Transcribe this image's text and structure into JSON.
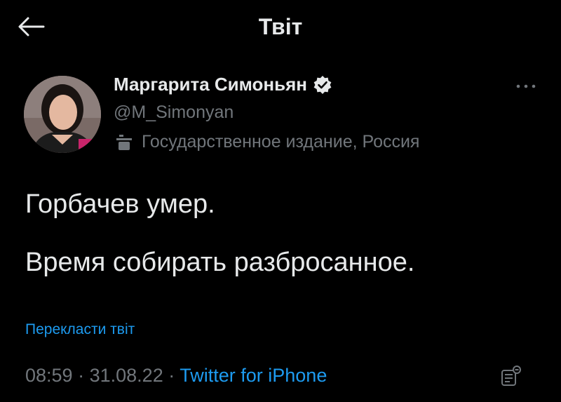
{
  "header": {
    "title": "Твіт",
    "back_icon": "arrow-left-icon"
  },
  "author": {
    "name": "Маргарита Симоньян",
    "handle": "@M_Simonyan",
    "verified_icon": "verified-badge-icon",
    "affiliation_icon": "state-media-podium-icon",
    "affiliation": "Государственное издание, Россия"
  },
  "tweet": {
    "line1": "Горбачев умер.",
    "line2": "Время собирать разбросанное.",
    "translate_label": "Перекласти твіт"
  },
  "meta": {
    "time": "08:59",
    "separator": "·",
    "date": "31.08.22",
    "source": "Twitter for iPhone",
    "analytics_icon": "analytics-icon"
  },
  "more_icon": "more-horizontal-icon",
  "colors": {
    "background": "#000000",
    "text": "#e7e9ea",
    "muted": "#71767b",
    "link": "#1d9bf0"
  }
}
